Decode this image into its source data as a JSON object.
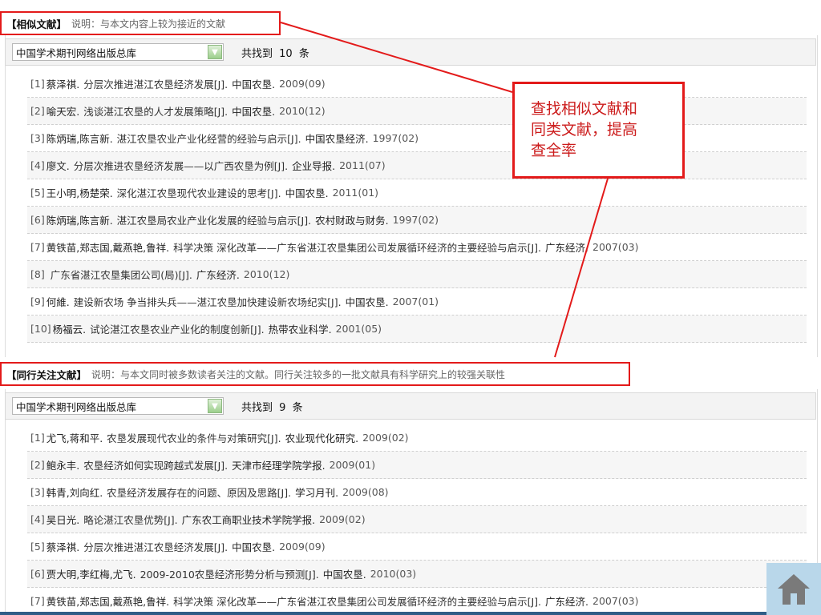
{
  "similar": {
    "title": "【相似文献】",
    "desc": "说明：与本文内容上较为接近的文献",
    "db": "中国学术期刊网络出版总库",
    "count_prefix": "共找到",
    "count": "10",
    "count_unit": "条",
    "items": [
      {
        "idx": "[1]",
        "author": "蔡泽祺.",
        "title": "分层次推进湛江农垦经济发展[J].",
        "source": "中国农垦.",
        "date": "2009(09)"
      },
      {
        "idx": "[2]",
        "author": "喻天宏.",
        "title": "浅谈湛江农垦的人才发展策略[J].",
        "source": "中国农垦.",
        "date": "2010(12)"
      },
      {
        "idx": "[3]",
        "author": "陈炳瑞,陈言新.",
        "title": "湛江农垦农业产业化经营的经验与启示[J].",
        "source": "中国农垦经济.",
        "date": "1997(02)"
      },
      {
        "idx": "[4]",
        "author": "廖文.",
        "title": "分层次推进农垦经济发展——以广西农垦为例[J].",
        "source": "企业导报.",
        "date": "2011(07)"
      },
      {
        "idx": "[5]",
        "author": "王小明,杨楚荣.",
        "title": "深化湛江农垦现代农业建设的思考[J].",
        "source": "中国农垦.",
        "date": "2011(01)"
      },
      {
        "idx": "[6]",
        "author": "陈炳瑞,陈言新.",
        "title": "湛江农垦局农业产业化发展的经验与启示[J].",
        "source": "农村财政与财务.",
        "date": "1997(02)"
      },
      {
        "idx": "[7]",
        "author": "黄铁苗,郑志国,戴燕艳,鲁祥.",
        "title": "科学决策 深化改革——广东省湛江农垦集团公司发展循环经济的主要经验与启示[J].",
        "source": "广东经济.",
        "date": "2007(03)"
      },
      {
        "idx": "[8]",
        "author": "",
        "title": "广东省湛江农垦集团公司(局)[J].",
        "source": "广东经济.",
        "date": "2010(12)"
      },
      {
        "idx": "[9]",
        "author": "何維.",
        "title": "建设新农场 争当排头兵——湛江农垦加快建设新农场纪实[J].",
        "source": "中国农垦.",
        "date": "2007(01)"
      },
      {
        "idx": "[10]",
        "author": "杨福云.",
        "title": "试论湛江农垦农业产业化的制度创新[J].",
        "source": "热带农业科学.",
        "date": "2001(05)"
      }
    ]
  },
  "peer": {
    "title": "【同行关注文献】",
    "desc": "说明：与本文同时被多数读者关注的文献。同行关注较多的一批文献具有科学研究上的较强关联性",
    "db": "中国学术期刊网络出版总库",
    "count_prefix": "共找到",
    "count": "9",
    "count_unit": "条",
    "items": [
      {
        "idx": "[1]",
        "author": "尤飞,蒋和平.",
        "title": "农垦发展现代农业的条件与对策研究[J].",
        "source": "农业现代化研究.",
        "date": "2009(02)"
      },
      {
        "idx": "[2]",
        "author": "鲍永丰.",
        "title": "农垦经济如何实现跨越式发展[J].",
        "source": "天津市经理学院学报.",
        "date": "2009(01)"
      },
      {
        "idx": "[3]",
        "author": "韩青,刘向红.",
        "title": "农垦经济发展存在的问题、原因及思路[J].",
        "source": "学习月刊.",
        "date": "2009(08)"
      },
      {
        "idx": "[4]",
        "author": "吴日光.",
        "title": "略论湛江农垦优势[J].",
        "source": "广东农工商职业技术学院学报.",
        "date": "2009(02)"
      },
      {
        "idx": "[5]",
        "author": "蔡泽祺.",
        "title": "分层次推进湛江农垦经济发展[J].",
        "source": "中国农垦.",
        "date": "2009(09)"
      },
      {
        "idx": "[6]",
        "author": "贾大明,李红梅,尤飞.",
        "title": "2009-2010农垦经济形势分析与预测[J].",
        "source": "中国农垦.",
        "date": "2010(03)"
      },
      {
        "idx": "[7]",
        "author": "黄铁苗,郑志国,戴燕艳,鲁祥.",
        "title": "科学决策 深化改革——广东省湛江农垦集团公司发展循环经济的主要经验与启示[J].",
        "source": "广东经济.",
        "date": "2007(03)"
      }
    ]
  },
  "callout": {
    "line1": "查找相似文献和",
    "line2": "同类文献，提高",
    "line3": "查全率"
  },
  "colors": {
    "accent_red": "#e31a1a",
    "callout_text": "#cc1d1d"
  },
  "icons": {
    "home": "home-icon",
    "dropdown": "chevron-down-icon"
  }
}
